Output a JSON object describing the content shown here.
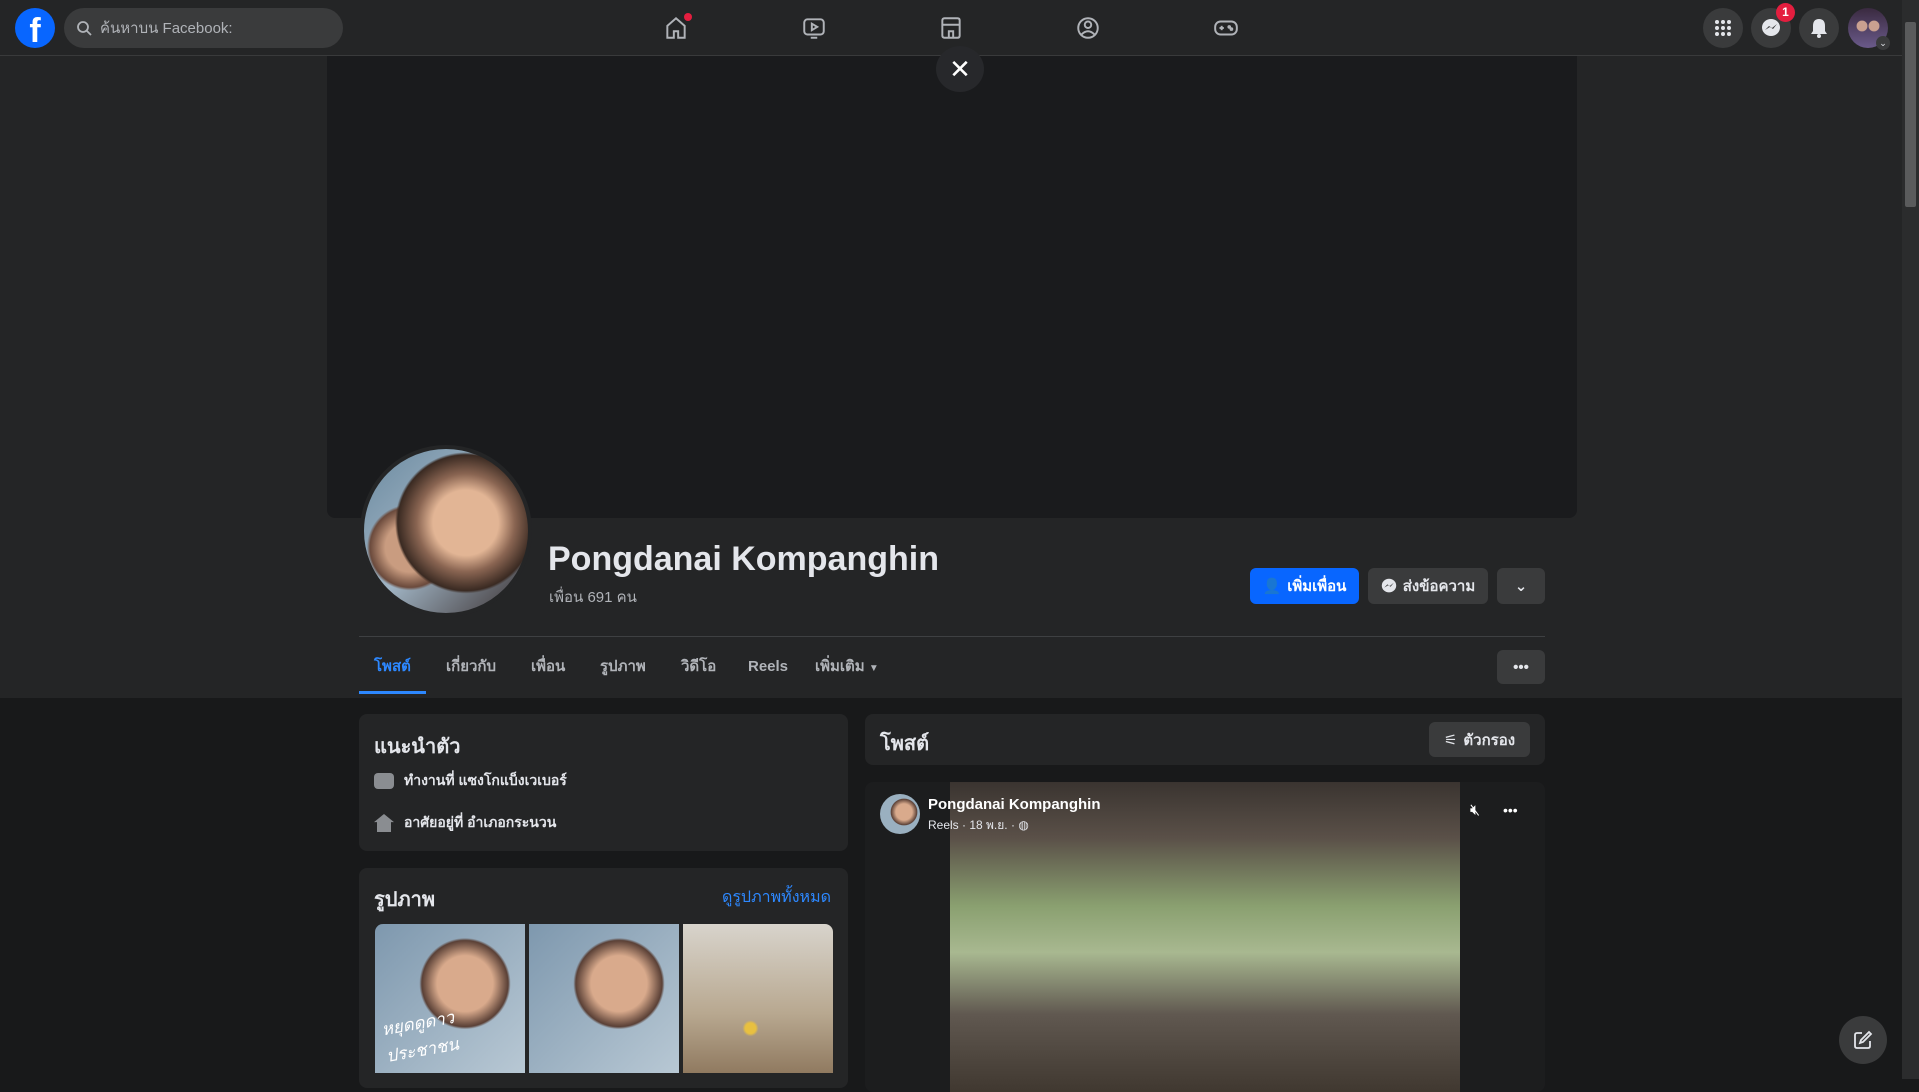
{
  "topbar": {
    "logo": "f",
    "search_placeholder": "ค้นหาบน Facebook:",
    "messenger_badge": "1",
    "nav": [
      "home-icon",
      "watch-icon",
      "marketplace-icon",
      "groups-icon",
      "gaming-icon"
    ]
  },
  "profile": {
    "name": "Pongdanai Kompanghin",
    "friends": "เพื่อน 691 คน",
    "add_friend": "เพิ่มเพื่อน",
    "message": "ส่งข้อความ"
  },
  "tabs": [
    "โพสต์",
    "เกี่ยวกับ",
    "เพื่อน",
    "รูปภาพ",
    "วิดีโอ",
    "Reels",
    "เพิ่มเติม"
  ],
  "intro": {
    "title": "แนะนำตัว",
    "work": "ทำงานที่ แซงโกแบ็งเวเบอร์",
    "lives": "อาศัยอยู่ที่ อำเภอกระนวน"
  },
  "photos": {
    "title": "รูปภาพ",
    "see_all": "ดูรูปภาพทั้งหมด",
    "overlay_text": "หยุดดูดาว ประชาชน"
  },
  "posts": {
    "title": "โพสต์",
    "filter": "ตัวกรอง",
    "post": {
      "author": "Pongdanai Kompanghin",
      "meta": "Reels · 18 พ.ย. ·"
    }
  },
  "colors": {
    "accent": "#0866ff",
    "link": "#2d88ff",
    "badge": "#e41e3f"
  }
}
